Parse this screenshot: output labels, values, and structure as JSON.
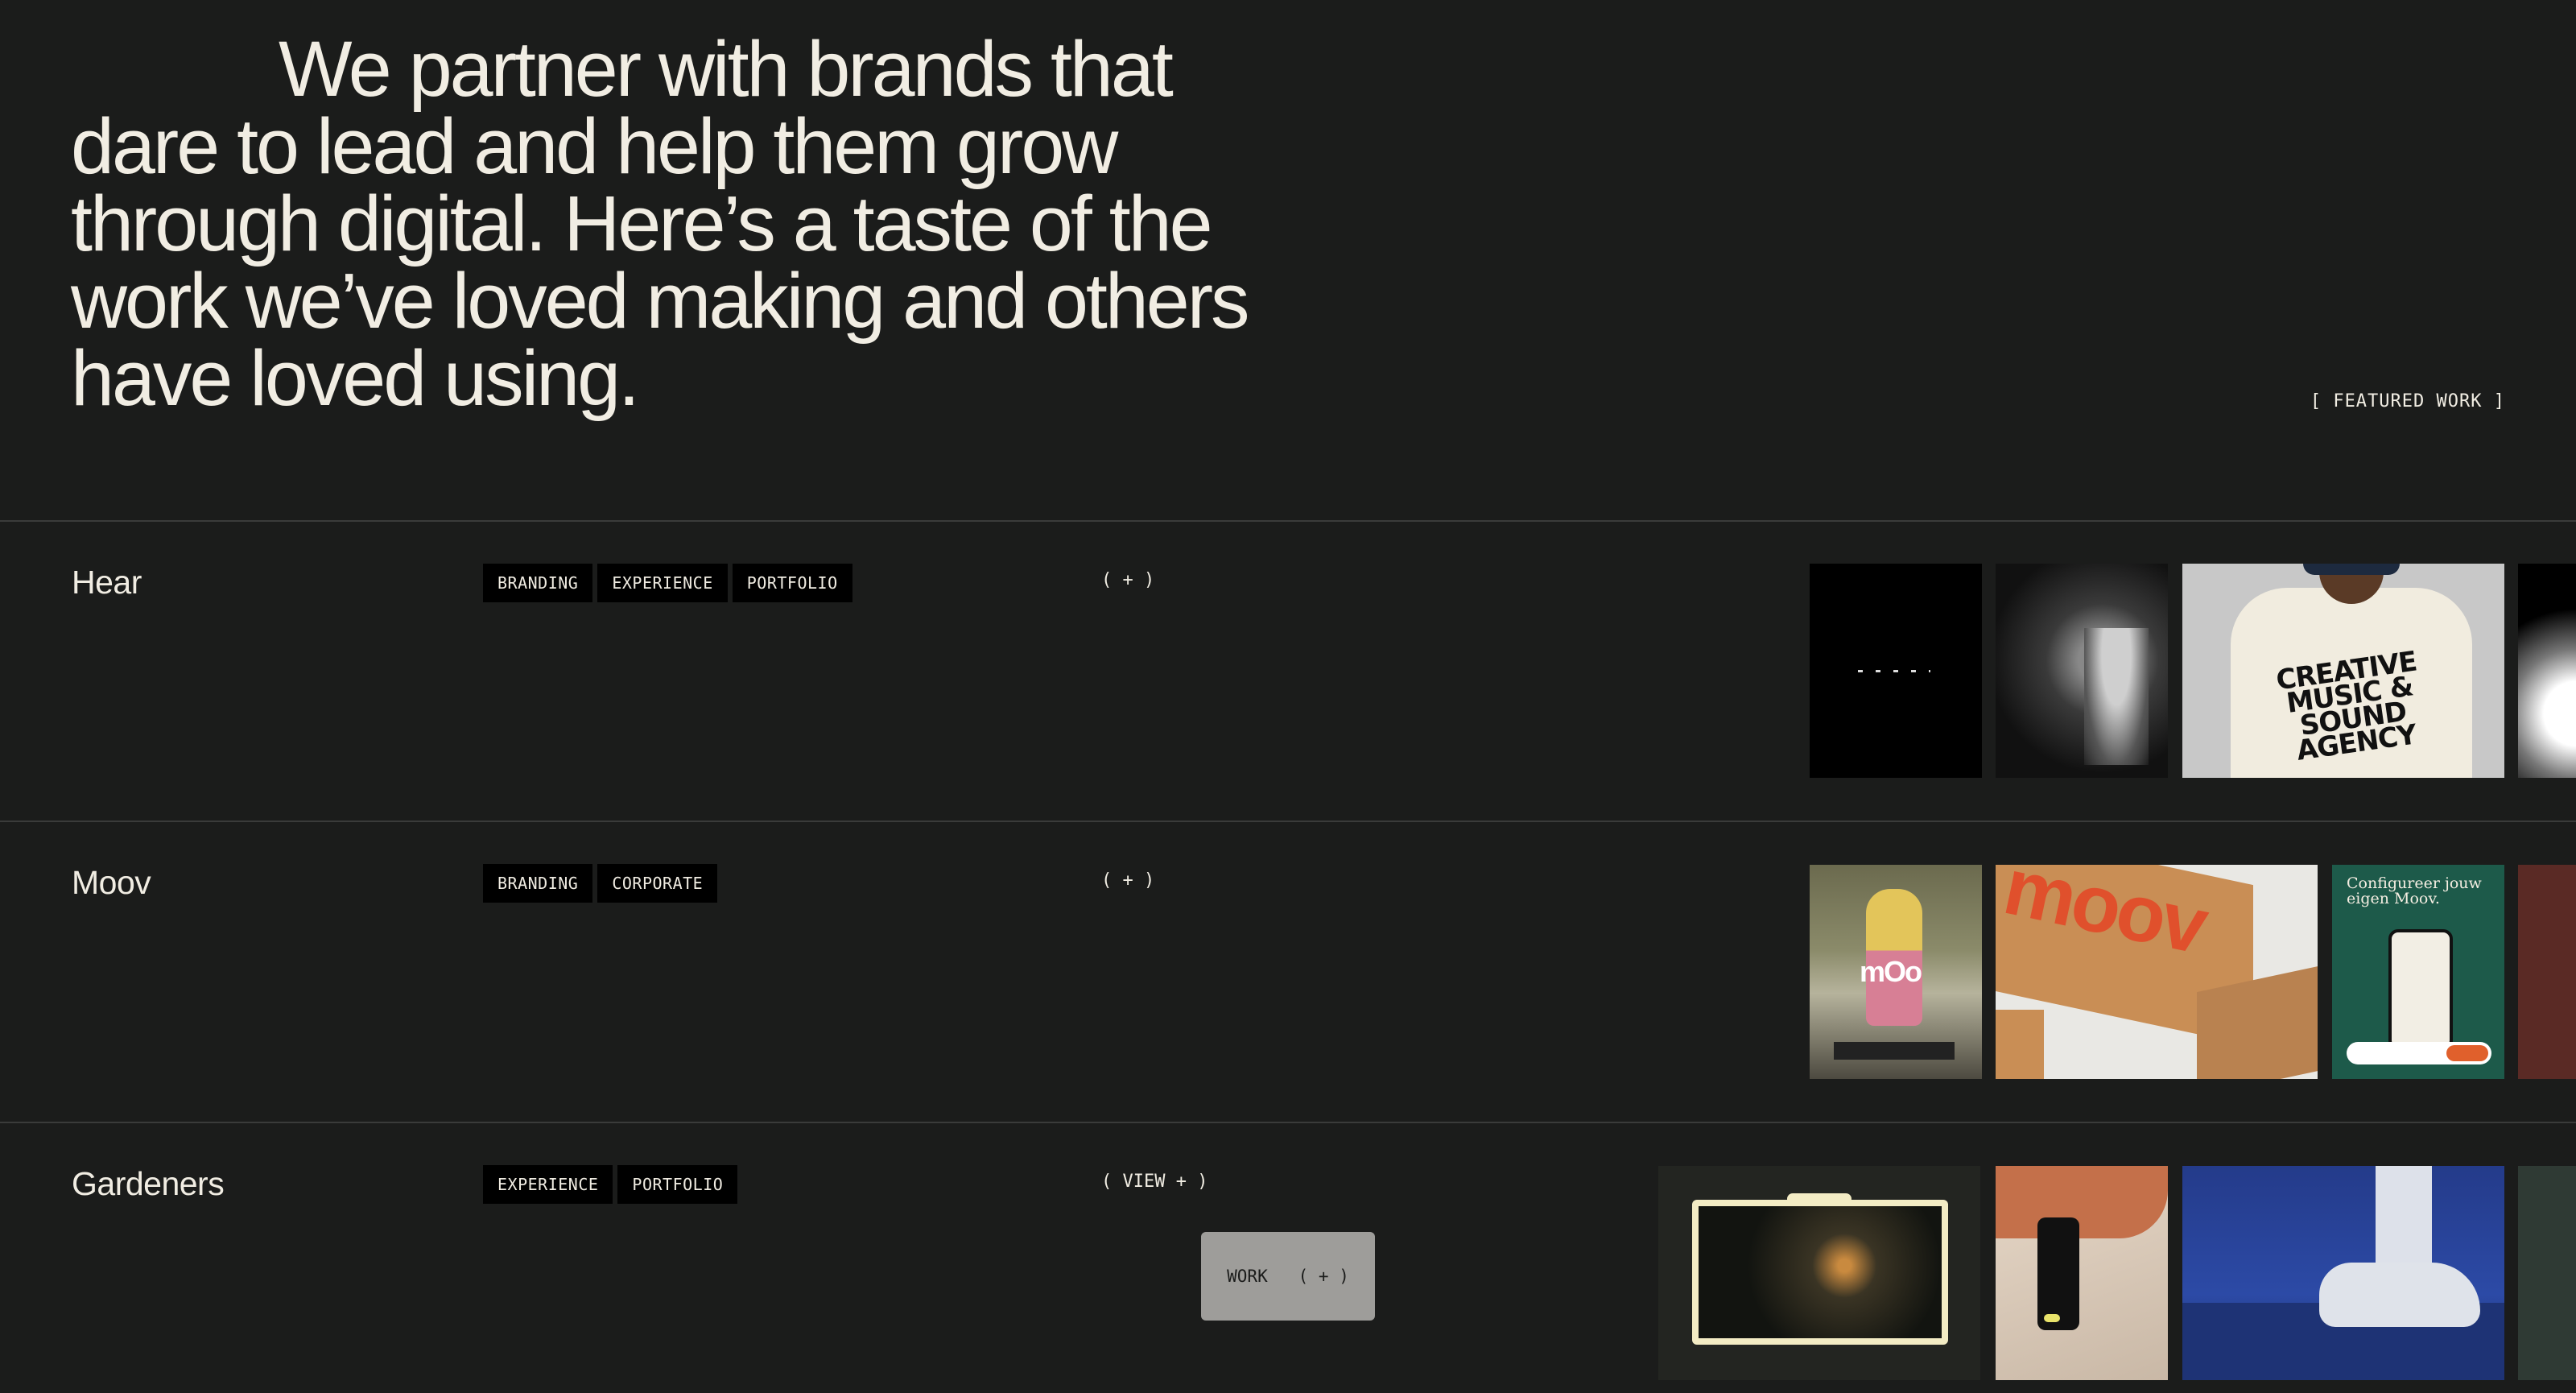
{
  "intro": {
    "text": "We partner with brands that dare to lead and help them grow through digital. Here’s a taste of the work we’ve loved making and others have loved using."
  },
  "featured_label": "[ FEATURED WORK ]",
  "projects": [
    {
      "title": "Hear",
      "tags": [
        "BRANDING",
        "EXPERIENCE",
        "PORTFOLIO"
      ],
      "toggle": "( + )",
      "thumb_text": "CREATIVE MUSIC & SOUND AGENCY"
    },
    {
      "title": "Moov",
      "tags": [
        "BRANDING",
        "CORPORATE"
      ],
      "toggle": "( + )",
      "thumb_logo": "mOo",
      "thumb_word": "moov",
      "thumb_caption": "Configureer jouw eigen Moov."
    },
    {
      "title": "Gardeners",
      "tags": [
        "EXPERIENCE",
        "PORTFOLIO"
      ],
      "toggle": "( VIEW + )",
      "hover_button": "WORK   ( + )"
    }
  ],
  "colors": {
    "background": "#1b1c1b",
    "text": "#f1ede3",
    "tag_bg": "#000000",
    "hover_button_bg": "#9e9d9a"
  }
}
